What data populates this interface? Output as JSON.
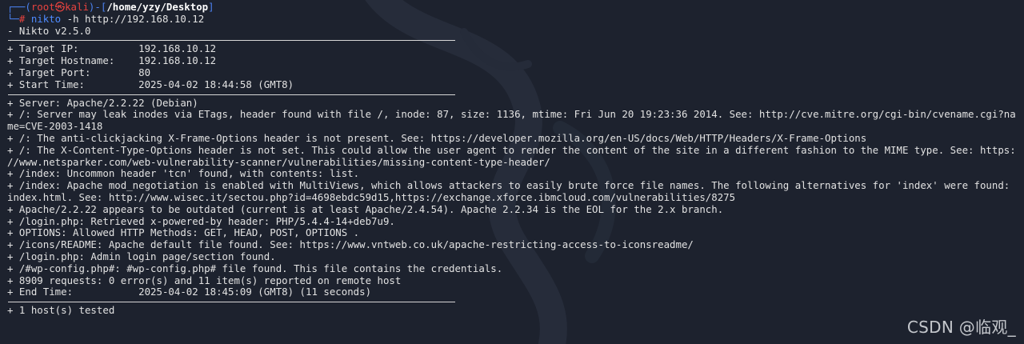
{
  "prompt": {
    "corner_top": "┌──(",
    "user": "root",
    "user_host_symbol": "㉿",
    "host": "kali",
    "mid": ")-[",
    "path": "/home/yzy/Desktop",
    "close": "]",
    "corner_bottom": "└─",
    "symbol": "# ",
    "command": "nikto",
    "command_args": " -h http://192.168.10.12"
  },
  "output": {
    "version_line": "- Nikto v2.5.0",
    "target_lines": [
      "+ Target IP:          192.168.10.12",
      "+ Target Hostname:    192.168.10.12",
      "+ Target Port:        80",
      "+ Start Time:         2025-04-02 18:44:58 (GMT8)"
    ],
    "finding_lines": [
      "+ Server: Apache/2.2.22 (Debian)",
      "+ /: Server may leak inodes via ETags, header found with file /, inode: 87, size: 1136, mtime: Fri Jun 20 19:23:36 2014. See: http://cve.mitre.org/cgi-bin/cvename.cgi?na",
      "me=CVE-2003-1418",
      "+ /: The anti-clickjacking X-Frame-Options header is not present. See: https://developer.mozilla.org/en-US/docs/Web/HTTP/Headers/X-Frame-Options",
      "+ /: The X-Content-Type-Options header is not set. This could allow the user agent to render the content of the site in a different fashion to the MIME type. See: https:",
      "//www.netsparker.com/web-vulnerability-scanner/vulnerabilities/missing-content-type-header/",
      "+ /index: Uncommon header 'tcn' found, with contents: list.",
      "+ /index: Apache mod_negotiation is enabled with MultiViews, which allows attackers to easily brute force file names. The following alternatives for 'index' were found:",
      "index.html. See: http://www.wisec.it/sectou.php?id=4698ebdc59d15,https://exchange.xforce.ibmcloud.com/vulnerabilities/8275",
      "+ Apache/2.2.22 appears to be outdated (current is at least Apache/2.4.54). Apache 2.2.34 is the EOL for the 2.x branch.",
      "+ /login.php: Retrieved x-powered-by header: PHP/5.4.4-14+deb7u9.",
      "+ OPTIONS: Allowed HTTP Methods: GET, HEAD, POST, OPTIONS .",
      "+ /icons/README: Apache default file found. See: https://www.vntweb.co.uk/apache-restricting-access-to-iconsreadme/",
      "+ /login.php: Admin login page/section found.",
      "+ /#wp-config.php#: #wp-config.php# file found. This file contains the credentials.",
      "+ 8909 requests: 0 error(s) and 11 item(s) reported on remote host",
      "+ End Time:           2025-04-02 18:45:09 (GMT8) (11 seconds)"
    ],
    "summary_line": "+ 1 host(s) tested"
  },
  "watermark": "CSDN @临观_",
  "colors": {
    "background": "#1d222e",
    "text": "#e2e2e2",
    "prompt_blue": "#4b82f0",
    "prompt_red": "#e8433f",
    "command_blue": "#4f8bff"
  }
}
